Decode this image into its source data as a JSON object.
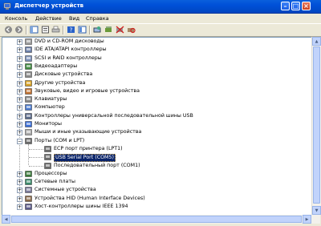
{
  "window": {
    "title": "Диспетчер устройств"
  },
  "menu": {
    "items": [
      "Консоль",
      "Действие",
      "Вид",
      "Справка"
    ]
  },
  "toolbar": {
    "buttons": [
      "back-icon",
      "forward-icon",
      "view-icon",
      "properties-icon",
      "print-icon",
      "help-icon",
      "view-alt-icon",
      "scan-icon",
      "update-driver-icon",
      "disable-icon",
      "uninstall-icon"
    ]
  },
  "tree": {
    "categories": [
      {
        "label": "DVD и CD-ROM дисководы",
        "icon": "cdrom-icon"
      },
      {
        "label": "IDE ATA/ATAPI контроллеры",
        "icon": "ide-icon"
      },
      {
        "label": "SCSI и RAID контроллеры",
        "icon": "scsi-icon"
      },
      {
        "label": "Видеоадаптеры",
        "icon": "display-adapter-icon"
      },
      {
        "label": "Дисковые устройства",
        "icon": "disk-icon"
      },
      {
        "label": "Другие устройства",
        "icon": "unknown-device-icon"
      },
      {
        "label": "Звуковые, видео и игровые устройства",
        "icon": "sound-icon"
      },
      {
        "label": "Клавиатуры",
        "icon": "keyboard-icon"
      },
      {
        "label": "Компьютер",
        "icon": "computer-icon"
      },
      {
        "label": "Контроллеры универсальной последовательной шины USB",
        "icon": "usb-icon"
      },
      {
        "label": "Мониторы",
        "icon": "monitor-icon"
      },
      {
        "label": "Мыши и иные указывающие устройства",
        "icon": "mouse-icon"
      },
      {
        "label": "Порты (COM и LPT)",
        "icon": "port-icon"
      },
      {
        "label": "Процессоры",
        "icon": "processor-icon"
      },
      {
        "label": "Сетевые платы",
        "icon": "network-icon"
      },
      {
        "label": "Системные устройства",
        "icon": "system-icon"
      },
      {
        "label": "Устройства HID (Human Interface Devices)",
        "icon": "hid-icon"
      },
      {
        "label": "Хост-контроллеры шины IEEE 1394",
        "icon": "ieee1394-icon"
      }
    ],
    "ports_children": [
      {
        "label": "ECP порт принтера (LPT1)"
      },
      {
        "label": "USB Serial Port (COM5)",
        "selected": true
      },
      {
        "label": "Последовательный порт (COM1)"
      }
    ]
  },
  "colors": {
    "titlebar": "#0054e3",
    "selection": "#0a246a",
    "window_bg": "#ece9d8"
  }
}
